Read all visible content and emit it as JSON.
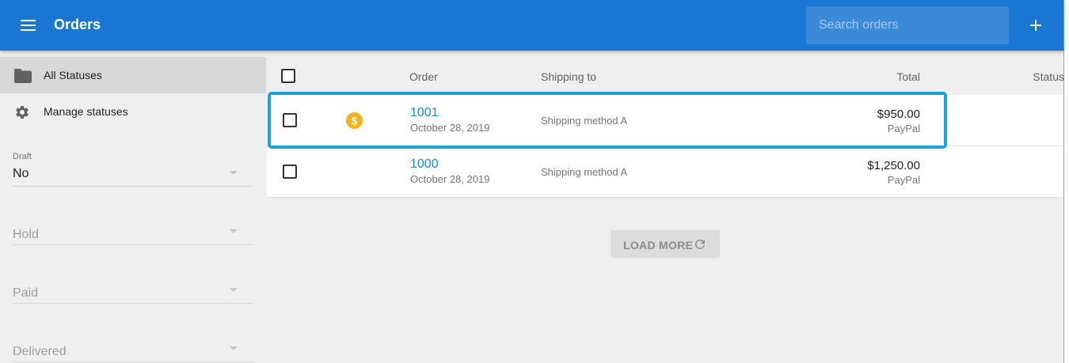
{
  "appbar": {
    "title": "Orders",
    "search_placeholder": "Search orders",
    "menu_icon": "hamburger-menu-icon",
    "add_icon": "plus-icon",
    "color": "#1976d2"
  },
  "sidebar": {
    "items": [
      {
        "label": "All Statuses",
        "icon": "folder-icon",
        "active": true
      },
      {
        "label": "Manage statuses",
        "icon": "gear-icon",
        "active": false
      }
    ],
    "filters": [
      {
        "label": "Draft",
        "value": "No"
      },
      {
        "label": "",
        "placeholder": "Hold"
      },
      {
        "label": "",
        "placeholder": "Paid"
      },
      {
        "label": "",
        "placeholder": "Delivered"
      }
    ]
  },
  "table": {
    "columns": [
      "Order",
      "Shipping to",
      "Total",
      "Status"
    ],
    "rows": [
      {
        "number": "1001",
        "date": "October 28, 2019",
        "shipping": "Shipping method A",
        "total": "$950.00",
        "payment": "PayPal",
        "icon": "dollar-coin-icon",
        "highlighted": true
      },
      {
        "number": "1000",
        "date": "October 28, 2019",
        "shipping": "Shipping method A",
        "total": "$1,250.00",
        "payment": "PayPal",
        "icon": "",
        "highlighted": false
      }
    ]
  },
  "load_more": {
    "label": "LOAD MORE",
    "icon": "refresh-icon"
  },
  "colors": {
    "accent": "#1976d2",
    "link": "#1a8fbd",
    "highlight": "#1aa3d4",
    "coin": "#f5b21b"
  }
}
